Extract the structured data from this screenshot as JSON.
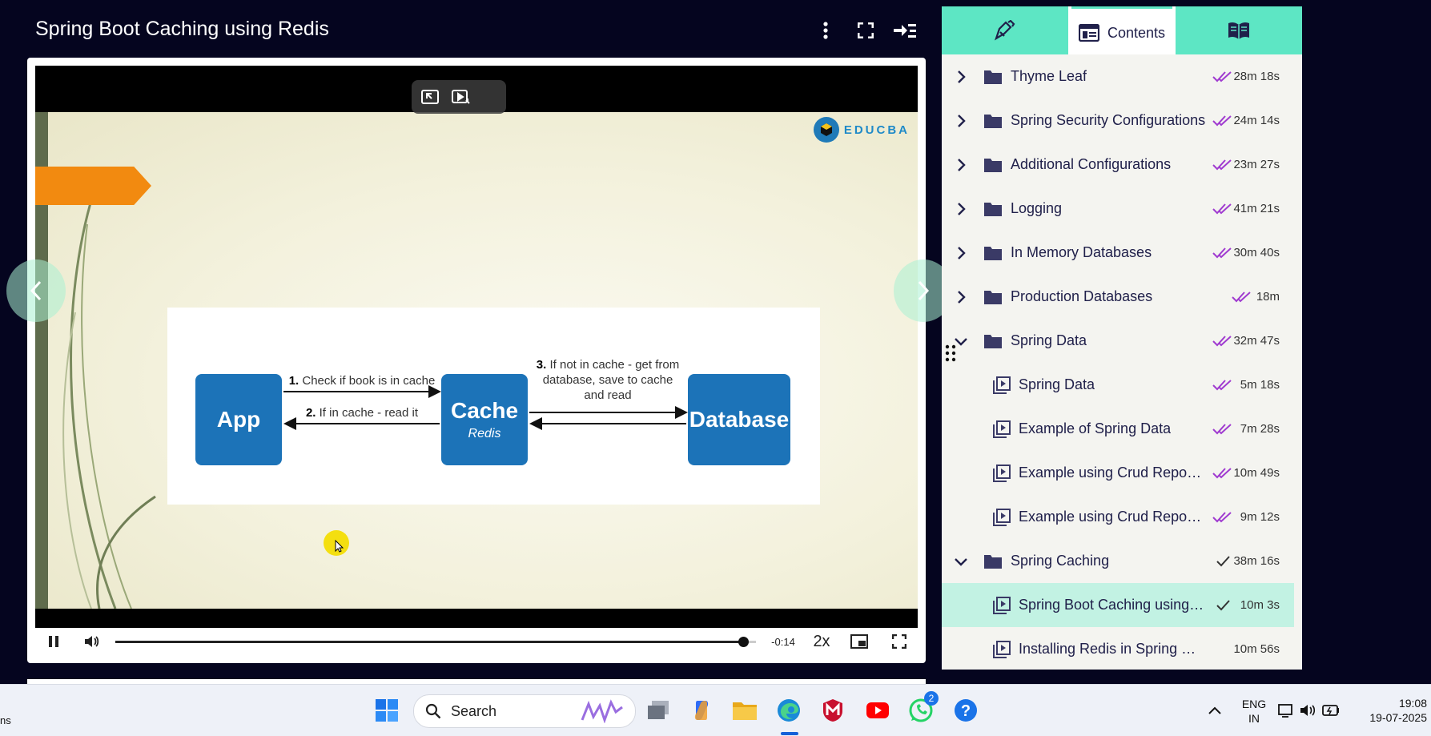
{
  "header": {
    "title": "Spring Boot Caching using Redis",
    "icons": [
      "more-vertical-icon",
      "fullscreen-icon",
      "collapse-sidebar-icon"
    ]
  },
  "video": {
    "logo_text": "EDUCBA",
    "diagram": {
      "app_label": "App",
      "cache_label": "Cache",
      "cache_sub": "Redis",
      "db_label": "Database",
      "step1_num": "1.",
      "step1_text": "Check if book is in cache",
      "step2_num": "2.",
      "step2_text": "If in cache - read it",
      "step3_num": "3.",
      "step3_line1": "If not in cache - get from",
      "step3_line2": "database, save to cache",
      "step3_line3": "and read"
    },
    "progress": 0.98
  },
  "controls": {
    "time_remaining": "-0:14",
    "speed": "2x"
  },
  "sidebar": {
    "tabs": [
      {
        "label": "",
        "icon": "notes-icon"
      },
      {
        "label": "Contents",
        "icon": "contents-icon"
      },
      {
        "label": "",
        "icon": "book-icon"
      }
    ],
    "items": [
      {
        "title": "Thyme Leaf",
        "duration": "28m 18s",
        "type": "section",
        "expanded": false,
        "check": "double"
      },
      {
        "title": "Spring Security Configurations",
        "duration": "24m 14s",
        "type": "section",
        "expanded": false,
        "check": "double"
      },
      {
        "title": "Additional Configurations",
        "duration": "23m 27s",
        "type": "section",
        "expanded": false,
        "check": "double"
      },
      {
        "title": "Logging",
        "duration": "41m 21s",
        "type": "section",
        "expanded": false,
        "check": "double"
      },
      {
        "title": "In Memory Databases",
        "duration": "30m 40s",
        "type": "section",
        "expanded": false,
        "check": "double"
      },
      {
        "title": "Production Databases",
        "duration": "18m",
        "type": "section",
        "expanded": false,
        "check": "double"
      },
      {
        "title": "Spring Data",
        "duration": "32m 47s",
        "type": "section",
        "expanded": true,
        "check": "double"
      },
      {
        "title": "Spring Data",
        "duration": "5m 18s",
        "type": "video",
        "check": "double"
      },
      {
        "title": "Example of Spring Data",
        "duration": "7m 28s",
        "type": "video",
        "check": "double"
      },
      {
        "title": "Example using Crud Reposi...",
        "duration": "10m 49s",
        "type": "video",
        "check": "double"
      },
      {
        "title": "Example using Crud Reposit...",
        "duration": "9m 12s",
        "type": "video",
        "check": "double"
      },
      {
        "title": "Spring Caching",
        "duration": "38m 16s",
        "type": "section",
        "expanded": true,
        "check": "single"
      },
      {
        "title": "Spring Boot Caching using R...",
        "duration": "10m 3s",
        "type": "video",
        "check": "single",
        "active": true
      },
      {
        "title": "Installing Redis in Spring Cachi...",
        "duration": "10m 56s",
        "type": "video",
        "check": "none"
      }
    ]
  },
  "taskbar": {
    "left_text": "ns",
    "search_label": "Search",
    "whatsapp_badge": "2",
    "lang_line1": "ENG",
    "lang_line2": "IN",
    "time": "19:08",
    "date": "19-07-2025"
  },
  "colors": {
    "accent": "#5de6c4",
    "check": "#a03bd0",
    "diagram_box": "#1c73b8",
    "background": "#05051f"
  }
}
